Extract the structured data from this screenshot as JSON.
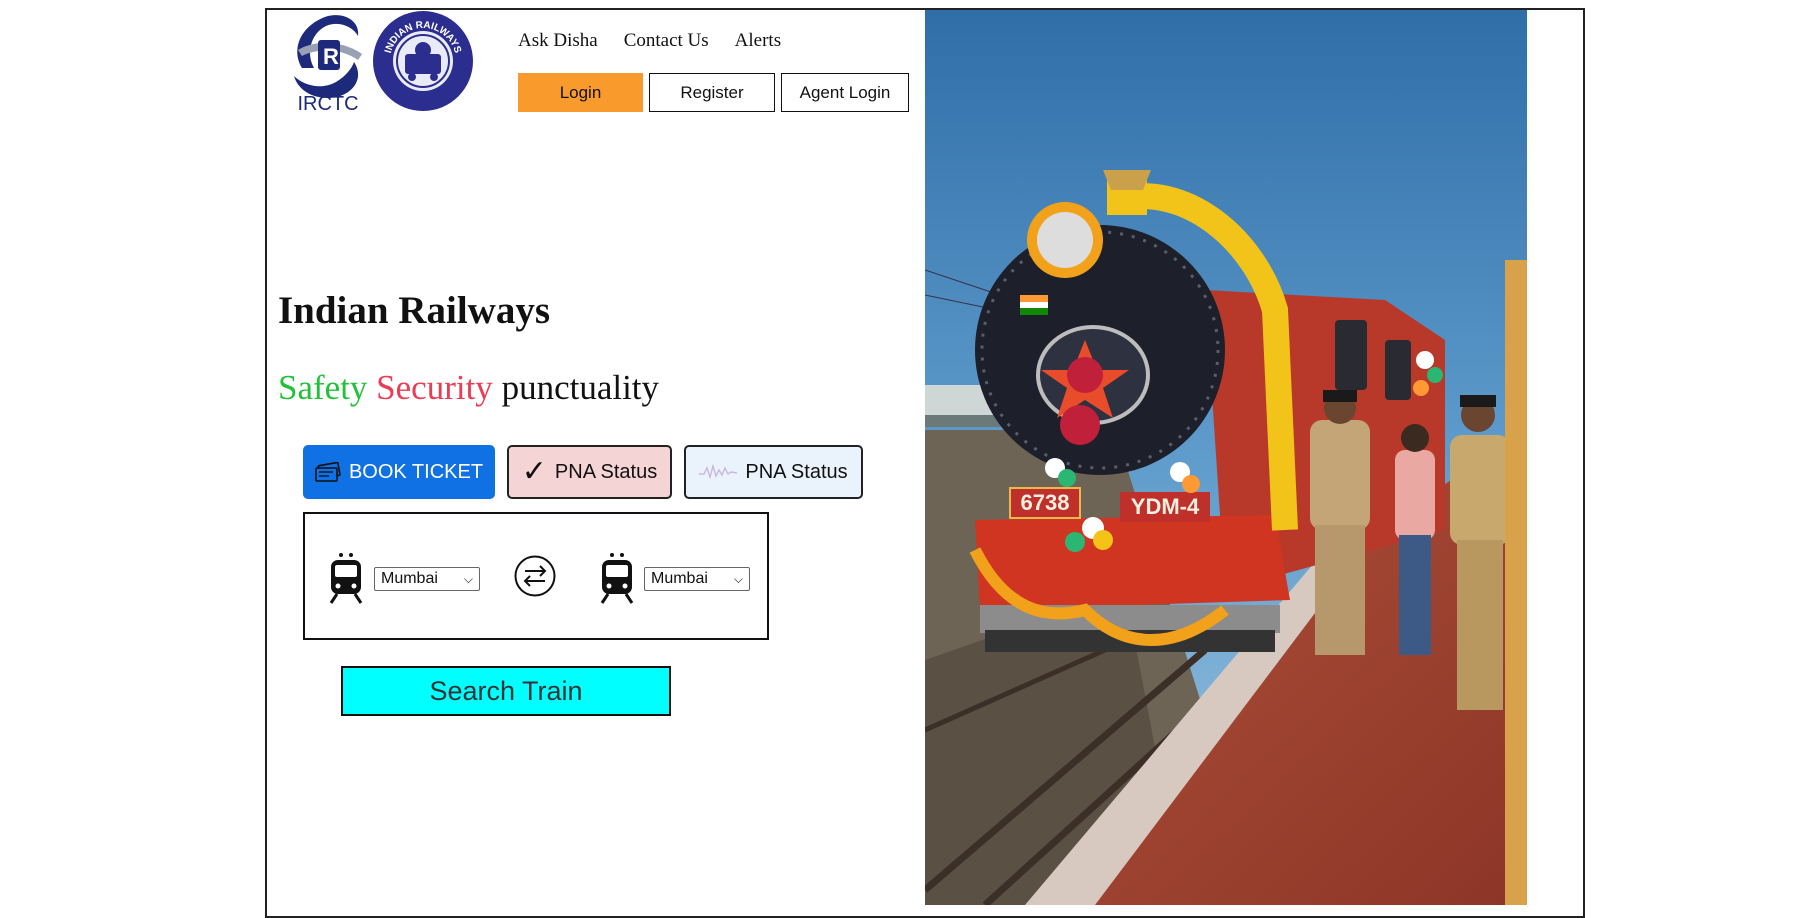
{
  "logos": {
    "irctc_text": "IRCTC",
    "indian_railways_text": "INDIAN RAILWAYS"
  },
  "nav": {
    "items": [
      "Ask Disha",
      "Contact Us",
      "Alerts"
    ]
  },
  "auth": {
    "login": "Login",
    "register": "Register",
    "agent_login": "Agent Login"
  },
  "hero": {
    "title": "Indian Railways",
    "tagline": {
      "safety": "Safety",
      "security": "Security",
      "punctuality": "punctuality"
    }
  },
  "actions": {
    "book_ticket": "BOOK TICKET",
    "pnr_status_1": "PNA Status",
    "pnr_status_2": "PNA Status"
  },
  "search": {
    "from_station": "Mumbai",
    "to_station": "Mumbai",
    "search_label": "Search Train"
  },
  "photo": {
    "engine_number": "6738",
    "engine_class": "YDM-4"
  },
  "colors": {
    "login": "#f99b2c",
    "book": "#1071e5",
    "search": "#00ffff",
    "safety": "#22c13a",
    "security": "#ea3c55"
  }
}
